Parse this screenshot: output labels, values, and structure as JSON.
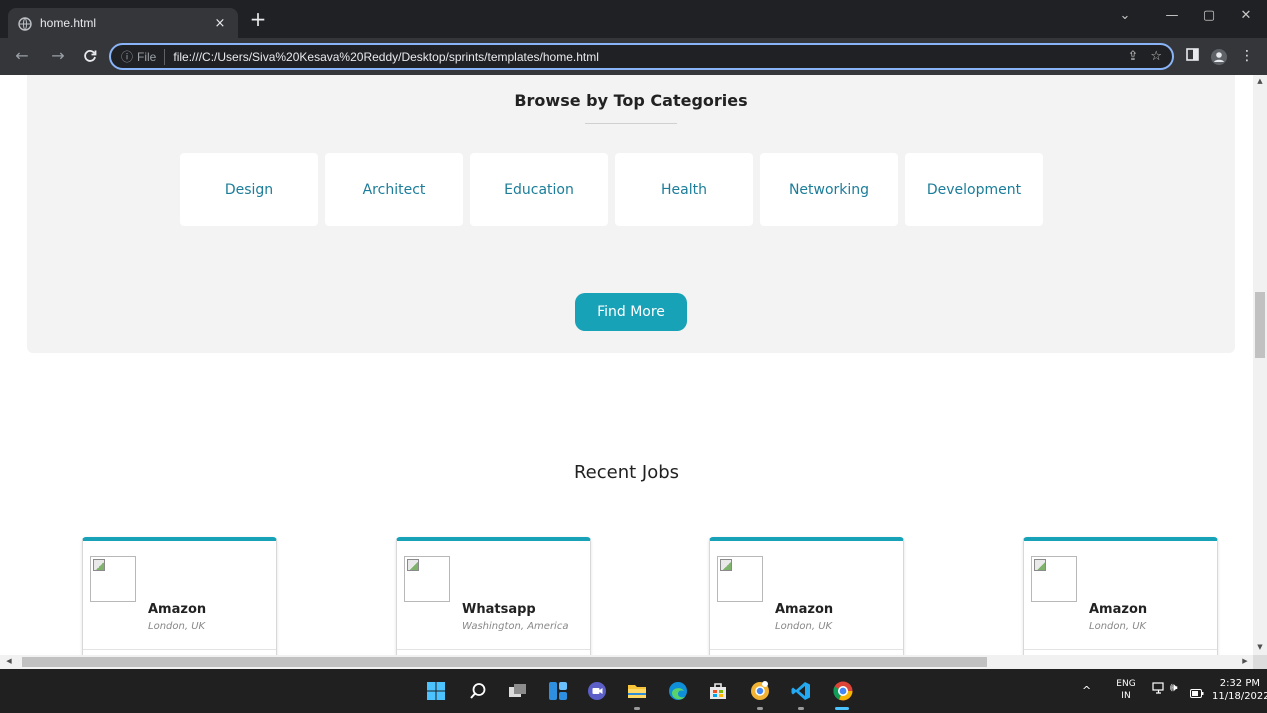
{
  "browser": {
    "tab_title": "home.html",
    "new_tab": "+",
    "tab_close": "×",
    "omnibox": {
      "info_glyph": "ⓘ",
      "label": "File",
      "url": "file:///C:/Users/Siva%20Kesava%20Reddy/Desktop/sprints/templates/home.html"
    },
    "window_controls": [
      "⌄",
      "—",
      "▢",
      "✕"
    ]
  },
  "page": {
    "categories": {
      "title": "Browse by Top Categories",
      "items": [
        "Design",
        "Architect",
        "Education",
        "Health",
        "Networking",
        "Development"
      ],
      "find_more_label": "Find More"
    },
    "recent_jobs": {
      "title": "Recent Jobs",
      "jobs": [
        {
          "company": "Amazon",
          "location": "London, UK"
        },
        {
          "company": "Whatsapp",
          "location": "Washington, America"
        },
        {
          "company": "Amazon",
          "location": "London, UK"
        },
        {
          "company": "Amazon",
          "location": "London, UK"
        }
      ]
    }
  },
  "taskbar": {
    "language": {
      "line1": "ENG",
      "line2": "IN"
    },
    "clock": {
      "time": "2:32 PM",
      "date": "11/18/2022"
    },
    "tray_chevron": "^"
  },
  "colors": {
    "accent": "#17a2b8",
    "category_text": "#1b7d99",
    "section_bg": "#f3f3f3",
    "chrome_dark": "#202124",
    "chrome_toolbar": "#35363a"
  }
}
